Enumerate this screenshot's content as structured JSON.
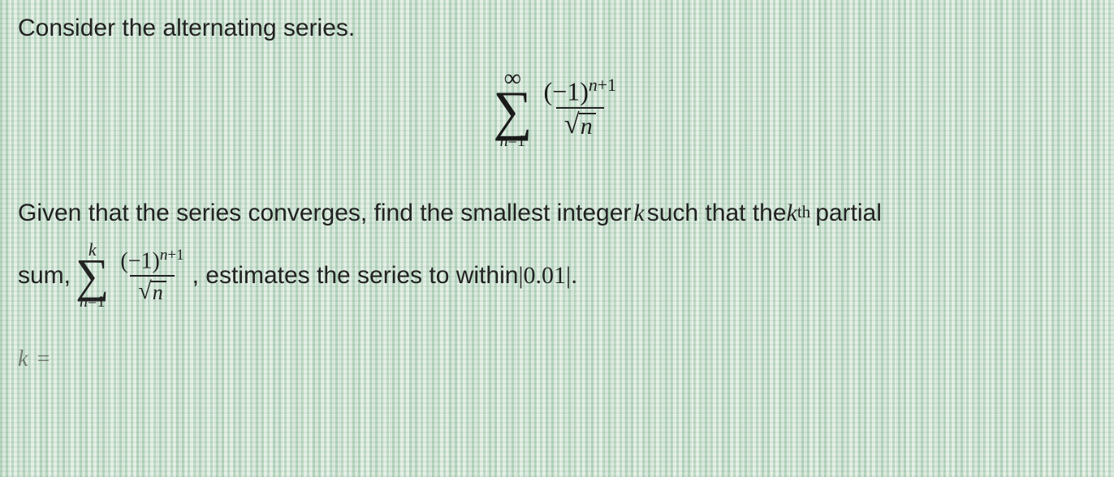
{
  "problem": {
    "intro": "Consider the alternating series.",
    "main_formula": {
      "sigma_top": "∞",
      "sigma_bottom_var": "n",
      "sigma_bottom_eq": "=",
      "sigma_bottom_val": "1",
      "numerator_base": "(−1)",
      "numerator_exp_var": "n",
      "numerator_exp_plus": "+",
      "numerator_exp_num": "1",
      "denom_sqrt_arg": "n"
    },
    "question_part1": "Given that the series converges, find the smallest integer ",
    "question_var1": "k",
    "question_part2": " such that the ",
    "question_var2": "k",
    "question_sup": "th",
    "question_part3": " partial",
    "line2_prefix": "sum, ",
    "partial_formula": {
      "sigma_top": "k",
      "sigma_bottom_var": "n",
      "sigma_bottom_eq": "=",
      "sigma_bottom_val": "1",
      "numerator_base": "(−1)",
      "numerator_exp_var": "n",
      "numerator_exp_plus": "+",
      "numerator_exp_num": "1",
      "denom_sqrt_arg": "n"
    },
    "line2_mid": ", estimates the series to within ",
    "tolerance": "0.01",
    "line2_end": ".",
    "answer_label_var": "k",
    "answer_label_eq": "="
  }
}
